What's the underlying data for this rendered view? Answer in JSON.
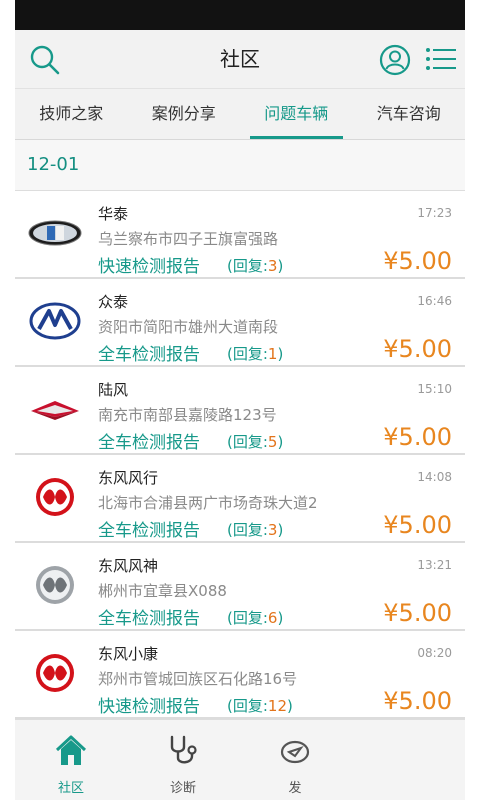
{
  "header": {
    "title": "社区"
  },
  "tabs": [
    {
      "label": "技师之家",
      "active": false
    },
    {
      "label": "案例分享",
      "active": false
    },
    {
      "label": "问题车辆",
      "active": true
    },
    {
      "label": "汽车咨询",
      "active": false
    }
  ],
  "date": "12-01",
  "items": [
    {
      "name": "华泰",
      "time": "17:23",
      "address": "乌兰察布市四子王旗富强路",
      "report": "快速检测报告",
      "reply_prefix": "(回复:",
      "reply_count": "3",
      "reply_suffix": ")",
      "price": "¥5.00",
      "logo": "huatai-logo"
    },
    {
      "name": "众泰",
      "time": "16:46",
      "address": "资阳市简阳市雄州大道南段",
      "report": "全车检测报告",
      "reply_prefix": "(回复:",
      "reply_count": "1",
      "reply_suffix": ")",
      "price": "¥5.00",
      "logo": "zotye-logo"
    },
    {
      "name": "陆风",
      "time": "15:10",
      "address": "南充市南部县嘉陵路123号",
      "report": "全车检测报告",
      "reply_prefix": "(回复:",
      "reply_count": "5",
      "reply_suffix": ")",
      "price": "¥5.00",
      "logo": "landwind-logo"
    },
    {
      "name": "东风风行",
      "time": "14:08",
      "address": "北海市合浦县两广市场奇珠大道2",
      "report": "全车检测报告",
      "reply_prefix": "(回复:",
      "reply_count": "3",
      "reply_suffix": ")",
      "price": "¥5.00",
      "logo": "dongfeng-red-logo"
    },
    {
      "name": "东风风神",
      "time": "13:21",
      "address": "郴州市宜章县X088",
      "report": "全车检测报告",
      "reply_prefix": "(回复:",
      "reply_count": "6",
      "reply_suffix": ")",
      "price": "¥5.00",
      "logo": "dongfeng-silver-logo"
    },
    {
      "name": "东风小康",
      "time": "08:20",
      "address": "郑州市管城回族区石化路16号",
      "report": "快速检测报告",
      "reply_prefix": "(回复:",
      "reply_count": "12",
      "reply_suffix": ")",
      "price": "¥5.00",
      "logo": "dongfeng-red-logo"
    }
  ],
  "bottom_nav": [
    {
      "label": "社区",
      "icon": "home-icon",
      "active": true
    },
    {
      "label": "诊断",
      "icon": "stethoscope-icon",
      "active": false
    },
    {
      "label": "发",
      "icon": "send-icon",
      "active": false
    }
  ],
  "colors": {
    "accent": "#17998a",
    "price": "#e8861f",
    "reply_count": "#e2741b"
  }
}
